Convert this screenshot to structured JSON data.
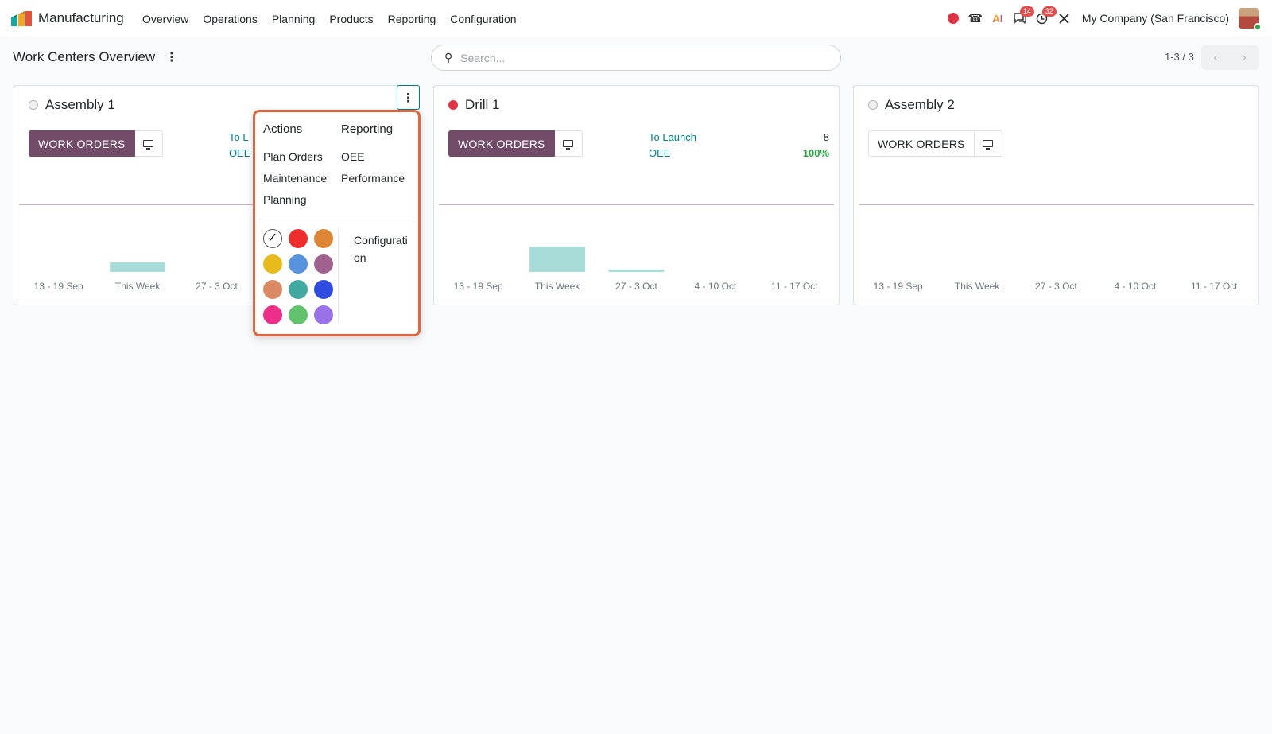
{
  "app": {
    "name": "Manufacturing"
  },
  "menu": [
    "Overview",
    "Operations",
    "Planning",
    "Products",
    "Reporting",
    "Configuration"
  ],
  "systray": {
    "messages_badge": "14",
    "activities_badge": "32",
    "company": "My Company (San Francisco)"
  },
  "control": {
    "title": "Work Centers Overview",
    "search_placeholder": "Search...",
    "pager": "1-3 / 3"
  },
  "cards": [
    {
      "name": "Assembly 1",
      "status": "grey",
      "work_orders_label": "WORK ORDERS",
      "to_launch_label": "To L",
      "to_launch_value": "",
      "oee_label": "OEE",
      "oee_value": ""
    },
    {
      "name": "Drill 1",
      "status": "red",
      "work_orders_label": "WORK ORDERS",
      "to_launch_label": "To Launch",
      "to_launch_value": "8",
      "oee_label": "OEE",
      "oee_value": "100%"
    },
    {
      "name": "Assembly 2",
      "status": "grey",
      "work_orders_label": "WORK ORDERS"
    }
  ],
  "dropdown": {
    "actions_header": "Actions",
    "actions": [
      "Plan Orders",
      "Maintenance",
      "Planning"
    ],
    "reporting_header": "Reporting",
    "reporting": [
      "OEE",
      "Performance"
    ],
    "colors": [
      "#ffffff",
      "#ee2d2d",
      "#dc8534",
      "#e8bb1d",
      "#5794dd",
      "#9f628f",
      "#db8865",
      "#41a9a2",
      "#304be0",
      "#ee2f8a",
      "#61c36e",
      "#9872e6"
    ],
    "config_label": "Configuration"
  },
  "chart_data": [
    {
      "type": "bar",
      "card": "Assembly 1",
      "categories": [
        "13 - 19 Sep",
        "This Week",
        "27 - 3 Oct"
      ],
      "values": [
        0,
        0.12,
        0
      ]
    },
    {
      "type": "bar",
      "card": "Drill 1",
      "categories": [
        "13 - 19 Sep",
        "This Week",
        "27 - 3 Oct",
        "4 - 10 Oct",
        "11 - 17 Oct"
      ],
      "values": [
        0,
        0.32,
        0.03,
        0,
        0
      ]
    },
    {
      "type": "bar",
      "card": "Assembly 2",
      "categories": [
        "13 - 19 Sep",
        "This Week",
        "27 - 3 Oct",
        "4 - 10 Oct",
        "11 - 17 Oct"
      ],
      "values": [
        0,
        0,
        0,
        0,
        0
      ]
    }
  ]
}
